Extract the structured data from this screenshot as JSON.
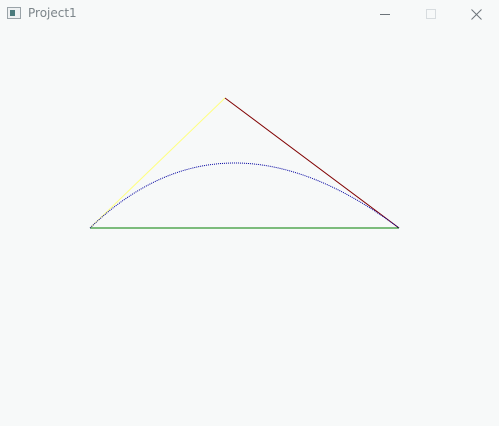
{
  "window": {
    "title": "Project1",
    "controls": {
      "minimize_icon": "minimize-icon",
      "maximize_icon": "maximize-icon",
      "close_icon": "close-icon"
    },
    "app_icon": "app-window-icon"
  },
  "drawing": {
    "description_elements": [
      "base-line",
      "left-tangent-line",
      "right-tangent-line",
      "curve"
    ],
    "colors": {
      "base_line": "#008000",
      "left_tangent_line": "#ffff80",
      "right_tangent_line": "#800000",
      "curve": "#0000a0",
      "background": "#f7f9f9"
    }
  }
}
